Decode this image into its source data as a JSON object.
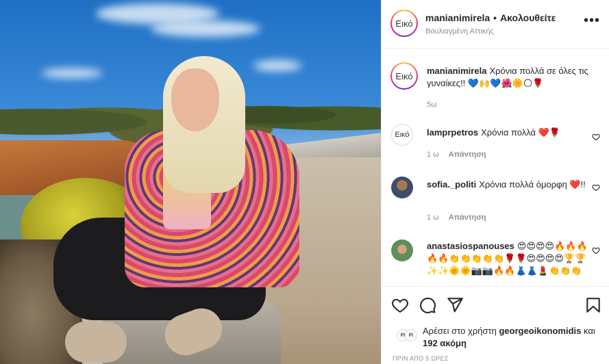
{
  "post": {
    "username": "manianimirela",
    "separator": "•",
    "follow_state": "Ακολουθείτε",
    "location": "Βουλιαγμένη Αττικής",
    "avatar_placeholder": "Εικό",
    "more_icon": "more-horizontal-icon"
  },
  "caption": {
    "avatar_placeholder": "Εικό",
    "username": "manianimirela",
    "text": "Χρόνια πολλά σε όλες τις γυναίκες!! 💙🙌💙🌺🌼🌕🌹",
    "time": "5ω"
  },
  "comments": [
    {
      "avatar_placeholder": "Εικό",
      "username": "lamprpetros",
      "text": "Χρόνια πολλά ❤️🌹",
      "time": "1 ω",
      "reply_label": "Απάντηση"
    },
    {
      "username": "sofia._politi",
      "text": "Χρόνια πολλά όμορφη ❤️!!",
      "time": "1 ω",
      "reply_label": "Απάντηση"
    },
    {
      "username": "anastasiospanouses",
      "text": "😍😍😍😍🔥🔥🔥🔥🔥👏👏👏👏👏🌹🌹😍😍😍😍🏆🏆✨✨🌞🌞📷📷🔥🔥👗👗💄👏👏👏"
    }
  ],
  "actions": {
    "like_icon": "heart-icon",
    "comment_icon": "comment-icon",
    "share_icon": "share-icon",
    "save_icon": "bookmark-icon"
  },
  "likes": {
    "liker_badges": [
      "Fl",
      "Fl"
    ],
    "prefix": "Αρέσει στο χρήστη ",
    "user": "georgeoikonomidis",
    "suffix_pre": " και ",
    "others": "192 ακόμη"
  },
  "timestamp": "ΠΡΙΝ ΑΠΟ 5 ΩΡΕΣ"
}
